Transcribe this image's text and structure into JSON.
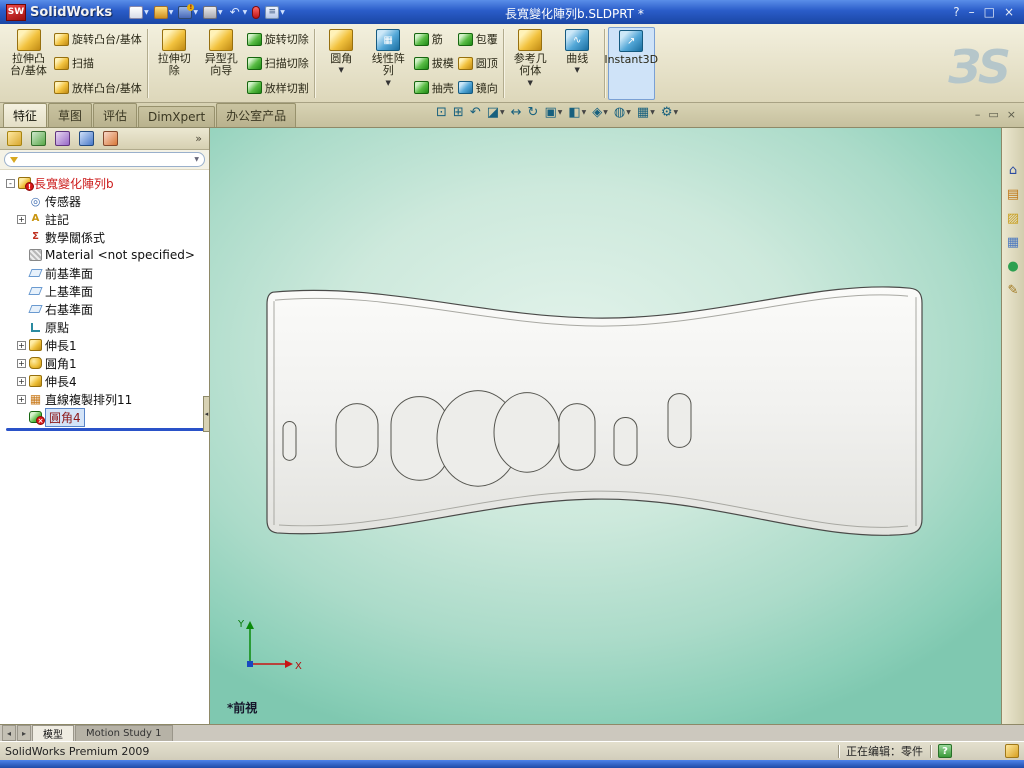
{
  "titlebar": {
    "logo": "SW",
    "app_name": "SolidWorks",
    "doc_title": "長寬變化陣列b.SLDPRT *"
  },
  "ribbon": {
    "extrude_boss": "拉伸凸台/基体",
    "revolve_boss": "旋转凸台/基体",
    "sweep": "扫描",
    "loft_boss": "放样凸台/基体",
    "extrude_cut": "拉伸切除",
    "hole_wizard": "异型孔向导",
    "revolve_cut": "旋转切除",
    "sweep_cut": "扫描切除",
    "loft_cut": "放样切割",
    "fillet": "圆角",
    "linear_pattern": "线性阵列",
    "rib": "筋",
    "draft": "拔模",
    "shell": "抽壳",
    "wrap": "包覆",
    "dome": "圆顶",
    "mirror": "镜向",
    "ref_geometry": "参考几何体",
    "curves": "曲线",
    "instant3d": "Instant3D"
  },
  "command_tabs": {
    "features": "特征",
    "sketch": "草图",
    "evaluate": "评估",
    "dimxpert": "DimXpert",
    "office": "办公室产品"
  },
  "feature_tree": {
    "items": [
      {
        "label": "長寬變化陣列b"
      },
      {
        "label": "传感器"
      },
      {
        "label": "註記"
      },
      {
        "label": "數學關係式"
      },
      {
        "label": "Material <not specified>"
      },
      {
        "label": "前基準面"
      },
      {
        "label": "上基準面"
      },
      {
        "label": "右基準面"
      },
      {
        "label": "原點"
      },
      {
        "label": "伸長1"
      },
      {
        "label": "圓角1"
      },
      {
        "label": "伸長4"
      },
      {
        "label": "直線複製排列11"
      },
      {
        "label": "圓角4"
      }
    ]
  },
  "viewport": {
    "view_label": "*前視",
    "axis_x": "X",
    "axis_y": "Y"
  },
  "bottom_tabs": {
    "model": "模型",
    "motion": "Motion Study 1"
  },
  "status": {
    "left": "SolidWorks Premium 2009",
    "editing": "正在编辑：零件",
    "help": "?"
  },
  "watermark": "ЗS",
  "glyphs": {
    "warn": "!",
    "undo": "↶",
    "options": "≡",
    "dropdown": "▼",
    "win_help": "?",
    "win_min": "–",
    "win_max": "□",
    "win_close": "×",
    "doc_min": "–",
    "doc_restore": "▭",
    "doc_close": "×",
    "zoom_fit": "⊡",
    "zoom_area": "⊞",
    "previous_view": "↶",
    "section_view": "◪",
    "pan": "↔",
    "rotate_view": "↻",
    "view_orientation": "▣",
    "display_style": "◧",
    "hide_show": "◈",
    "edit_appearance": "◍",
    "apply_scene": "▦",
    "view_settings": "⚙",
    "overflow": "»",
    "expand_plus": "+",
    "expand_minus": "-",
    "sensors": "◎",
    "annotations": "A",
    "equations": "Σ",
    "pattern": "▦",
    "error": "×",
    "pattern_icon": "▦",
    "instant3d_icon": "↗",
    "curves_icon": "∿",
    "home": "⌂",
    "design_library": "▤",
    "file_explorer": "▨",
    "view_palette": "▦",
    "appearances": "●",
    "custom_props": "✎",
    "tab_left": "◂",
    "tab_right": "▸",
    "splitter": "◂"
  },
  "colors": {
    "titlebar_blue": "#2a5cc8",
    "ribbon_tan": "#e6e1c6",
    "viewport_teal": "#9ed6c2",
    "selection_blue": "#5884c8",
    "tree_root_red": "#cc1a1a",
    "rollback_blue": "#2a52c8"
  }
}
